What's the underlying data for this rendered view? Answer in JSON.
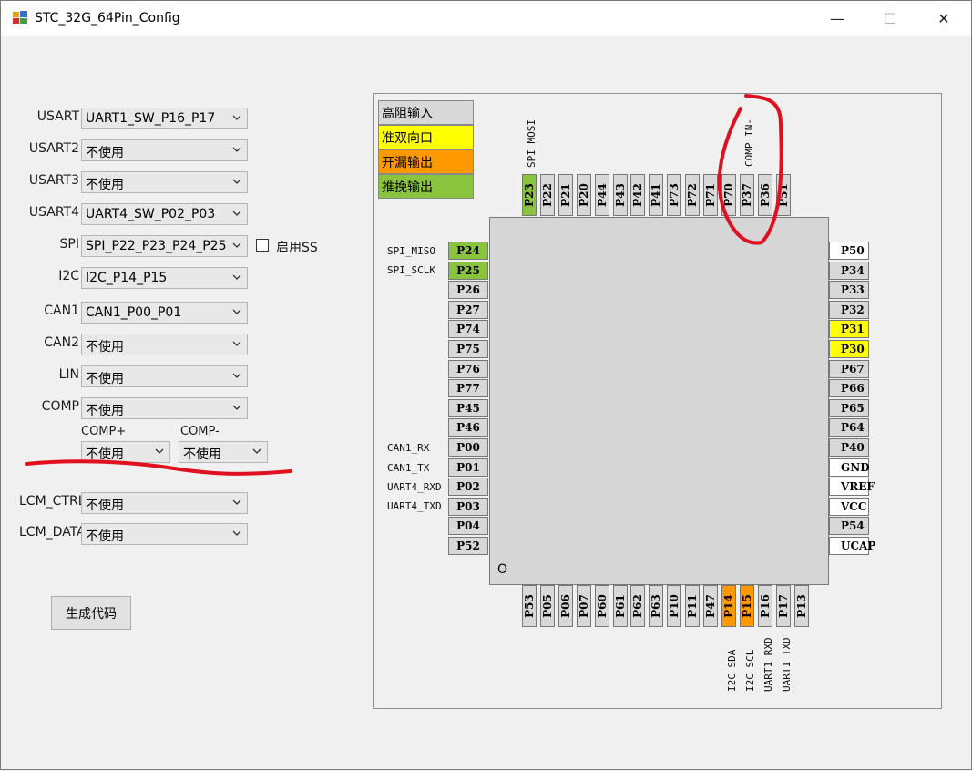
{
  "window": {
    "title": "STC_32G_64Pin_Config",
    "min": "—",
    "max": "☐",
    "close": "✕"
  },
  "config": [
    {
      "label": "USART",
      "value": "UART1_SW_P16_P17"
    },
    {
      "label": "USART2",
      "value": "不使用"
    },
    {
      "label": "USART3",
      "value": "不使用"
    },
    {
      "label": "USART4",
      "value": "UART4_SW_P02_P03"
    },
    {
      "label": "SPI",
      "value": "SPI_P22_P23_P24_P25"
    },
    {
      "label": "I2C",
      "value": "I2C_P14_P15"
    },
    {
      "label": "CAN1",
      "value": "CAN1_P00_P01"
    },
    {
      "label": "CAN2",
      "value": "不使用"
    },
    {
      "label": "LIN",
      "value": "不使用"
    },
    {
      "label": "COMP",
      "value": "不使用"
    }
  ],
  "spi_ss_label": "启用SS",
  "comp_plus": {
    "label": "COMP+",
    "value": "不使用"
  },
  "comp_minus": {
    "label": "COMP-",
    "value": "不使用"
  },
  "lcm_ctrl": {
    "label": "LCM_CTRL",
    "value": "不使用"
  },
  "lcm_data": {
    "label": "LCM_DATA",
    "value": "不使用"
  },
  "generate_button": "生成代码",
  "legend": [
    "高阻输入",
    "准双向口",
    "开漏输出",
    "推挽输出"
  ],
  "colors": {
    "gray": "#d8d8d8",
    "yellow": "#ffff00",
    "orange": "#ff9900",
    "green": "#8ac43f",
    "annotation": "#e01020"
  },
  "top_pins": [
    "P23",
    "P22",
    "P21",
    "P20",
    "P44",
    "P43",
    "P42",
    "P41",
    "P73",
    "P72",
    "P71",
    "P70",
    "P37",
    "P36",
    "P51"
  ],
  "top_labels": [
    "SPI MOSI",
    "COMP IN-"
  ],
  "left_pins": [
    "P24",
    "P25",
    "P26",
    "P27",
    "P74",
    "P75",
    "P76",
    "P77",
    "P45",
    "P46",
    "P00",
    "P01",
    "P02",
    "P03",
    "P04",
    "P52"
  ],
  "left_labels": [
    "SPI_MISO",
    "SPI_SCLK",
    "CAN1_RX",
    "CAN1_TX",
    "UART4_RXD",
    "UART4_TXD"
  ],
  "right_pins": [
    "P50",
    "P34",
    "P33",
    "P32",
    "P31",
    "P30",
    "P67",
    "P66",
    "P65",
    "P64",
    "P40",
    "GND",
    "VREF",
    "VCC",
    "P54",
    "UCAP"
  ],
  "bottom_pins": [
    "P53",
    "P05",
    "P06",
    "P07",
    "P60",
    "P61",
    "P62",
    "P63",
    "P10",
    "P11",
    "P47",
    "P14",
    "P15",
    "P16",
    "P17",
    "P13"
  ],
  "bottom_labels": [
    "I2C SDA",
    "I2C SCL",
    "UART1 RXD",
    "UART1 TXD"
  ],
  "chip_mark": "O"
}
